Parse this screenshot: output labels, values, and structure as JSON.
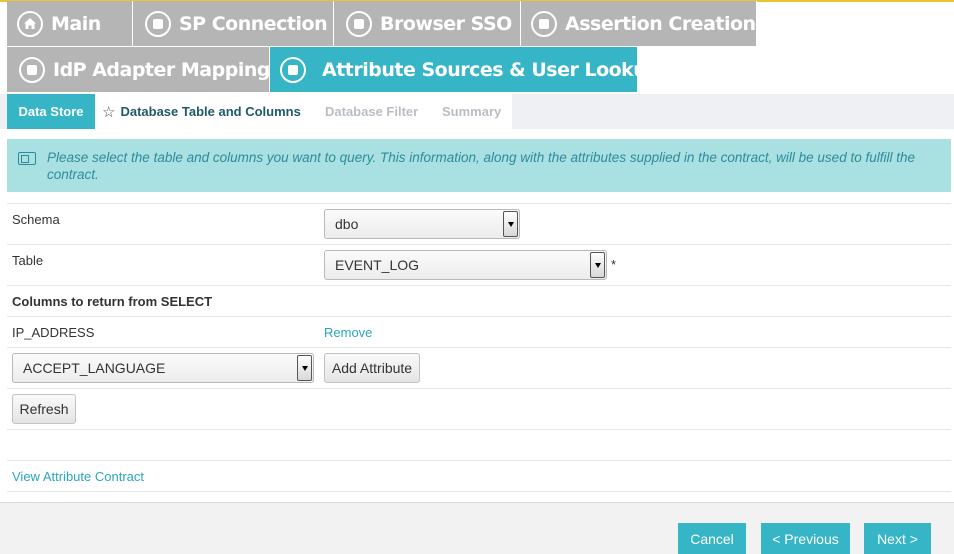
{
  "top_tabs": [
    {
      "label": "Main",
      "icon": "home-icon",
      "active": false
    },
    {
      "label": "SP Connection",
      "icon": "stop-icon",
      "active": false
    },
    {
      "label": "Browser SSO",
      "icon": "stop-icon",
      "active": false
    },
    {
      "label": "Assertion Creation",
      "icon": "stop-icon",
      "active": false
    },
    {
      "label": "IdP Adapter Mapping",
      "icon": "stop-icon",
      "active": false
    },
    {
      "label": "Attribute Sources & User Lookup",
      "icon": "stop-icon",
      "active": true
    }
  ],
  "sub_tabs": [
    {
      "label": "Data Store",
      "state": "done"
    },
    {
      "label": "Database Table and Columns",
      "state": "current"
    },
    {
      "label": "Database Filter",
      "state": "future"
    },
    {
      "label": "Summary",
      "state": "future"
    }
  ],
  "info": {
    "text": "Please select the table and columns you want to query. This information, along with the attributes supplied in the contract, will be used to fulfill the contract."
  },
  "form": {
    "schema_label": "Schema",
    "schema_value": "dbo",
    "table_label": "Table",
    "table_value": "EVENT_LOG",
    "required_mark": "*",
    "columns_heading": "Columns to return from SELECT",
    "column_name": "IP_ADDRESS",
    "remove_label": "Remove",
    "attribute_select_value": "ACCEPT_LANGUAGE",
    "add_attribute_label": "Add Attribute",
    "refresh_label": "Refresh",
    "view_contract_label": "View Attribute Contract"
  },
  "footer": {
    "cancel_label": "Cancel",
    "previous_label": "< Previous",
    "next_label": "Next >"
  },
  "colors": {
    "accent": "#35b5c6",
    "inactive_tab": "#b5b5b5",
    "info_bg": "#a9e1e2",
    "link": "#2aa7bd"
  }
}
